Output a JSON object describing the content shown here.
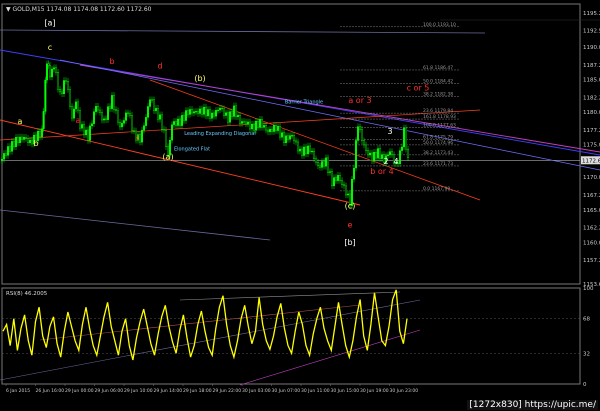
{
  "header": {
    "symbol": "GOLD,M15",
    "ohlc": "1174.08 1174.08 1172.60 1172.60"
  },
  "watermark": "[1272x830] https://upic.me/",
  "colors": {
    "bg": "#000000",
    "candle": "#00ff00",
    "price_line": "#aaaaaa",
    "rsi": "#ffff00",
    "wave_red": "#ff3030",
    "wave_yellow": "#ffff66",
    "wave_white": "#ffffff",
    "channel_blue": "#4040ff",
    "channel_red": "#ff4020",
    "channel_magenta": "#c040c0",
    "fib": "#808080",
    "annot": "#66ccff"
  },
  "chart_data": [
    {
      "type": "candlestick",
      "title": "GOLD,M15",
      "y_ticks": [
        1195.25,
        1192.5,
        1190.0,
        1187.25,
        1185.0,
        1182.25,
        1180.0,
        1177.25,
        1175.0,
        1172.6,
        1170.0,
        1167.25,
        1165.0,
        1162.25,
        1160.0,
        1157.25,
        1153.6
      ],
      "ylim": [
        1153.6,
        1196.6
      ],
      "current_price": 1172.6,
      "x_ticks": [
        "6 Jan 2015",
        "26 Jun 16:00",
        "29 Jun 00:00",
        "29 Jun 06:00",
        "29 Jun 10:00",
        "29 Jun 14:00",
        "29 Jun 18:00",
        "29 Jun 22:00",
        "30 Jun 03:00",
        "30 Jun 07:00",
        "30 Jun 11:00",
        "30 Jun 15:00",
        "30 Jun 19:00",
        "30 Jun 23:00"
      ],
      "close_path": [
        [
          0,
          1172.5
        ],
        [
          8,
          1174.2
        ],
        [
          16,
          1175.6
        ],
        [
          24,
          1176.1
        ],
        [
          30,
          1175.3
        ],
        [
          36,
          1176.2
        ],
        [
          42,
          1177.0
        ],
        [
          47,
          1188.0
        ],
        [
          50,
          1185.5
        ],
        [
          54,
          1187.2
        ],
        [
          60,
          1182.5
        ],
        [
          66,
          1185.2
        ],
        [
          72,
          1179.0
        ],
        [
          76,
          1181.8
        ],
        [
          80,
          1178.0
        ],
        [
          88,
          1176.2
        ],
        [
          96,
          1181.0
        ],
        [
          104,
          1178.5
        ],
        [
          112,
          1182.0
        ],
        [
          120,
          1177.6
        ],
        [
          128,
          1180.2
        ],
        [
          134,
          1176.5
        ],
        [
          140,
          1175.8
        ],
        [
          146,
          1179.2
        ],
        [
          150,
          1182.2
        ],
        [
          156,
          1180.0
        ],
        [
          160,
          1179.0
        ],
        [
          164,
          1176.8
        ],
        [
          168,
          1173.2
        ],
        [
          172,
          1178.2
        ],
        [
          180,
          1178.5
        ],
        [
          188,
          1180.1
        ],
        [
          196,
          1180.0
        ],
        [
          204,
          1180.2
        ],
        [
          212,
          1179.4
        ],
        [
          220,
          1180.7
        ],
        [
          228,
          1179.0
        ],
        [
          234,
          1180.4
        ],
        [
          240,
          1178.5
        ],
        [
          246,
          1178.4
        ],
        [
          252,
          1177.6
        ],
        [
          260,
          1178.4
        ],
        [
          268,
          1177.0
        ],
        [
          276,
          1177.7
        ],
        [
          284,
          1175.8
        ],
        [
          292,
          1176.4
        ],
        [
          300,
          1173.8
        ],
        [
          310,
          1174.4
        ],
        [
          318,
          1171.6
        ],
        [
          326,
          1172.4
        ],
        [
          332,
          1169.2
        ],
        [
          338,
          1170.1
        ],
        [
          344,
          1168.4
        ],
        [
          350,
          1166.2
        ],
        [
          354,
          1172.0
        ],
        [
          358,
          1178.2
        ],
        [
          362,
          1175.8
        ],
        [
          366,
          1174.0
        ],
        [
          372,
          1173.0
        ],
        [
          378,
          1173.8
        ],
        [
          384,
          1172.6
        ],
        [
          390,
          1174.0
        ],
        [
          396,
          1171.7
        ],
        [
          400,
          1173.5
        ],
        [
          404,
          1177.0
        ],
        [
          408,
          1172.6
        ]
      ],
      "wave_labels": [
        {
          "text": "[a]",
          "x": 50,
          "y": 1193.3,
          "color": "white"
        },
        {
          "text": "c",
          "x": 50,
          "y": 1189.5,
          "color": "yellow"
        },
        {
          "text": "b",
          "x": 112,
          "y": 1187.4,
          "color": "red"
        },
        {
          "text": "d",
          "x": 160,
          "y": 1186.7,
          "color": "red"
        },
        {
          "text": "(b)",
          "x": 200,
          "y": 1184.8,
          "color": "yellow"
        },
        {
          "text": "a",
          "x": 20,
          "y": 1178.2,
          "color": "yellow"
        },
        {
          "text": "b",
          "x": 36,
          "y": 1174.8,
          "color": "yellow"
        },
        {
          "text": "a",
          "x": 78,
          "y": 1178.3,
          "color": "red"
        },
        {
          "text": "c",
          "x": 138,
          "y": 1175.7,
          "color": "red"
        },
        {
          "text": "(a)",
          "x": 168,
          "y": 1172.7,
          "color": "yellow"
        },
        {
          "text": "a or 3",
          "x": 360,
          "y": 1181.4,
          "color": "red"
        },
        {
          "text": "c or 5",
          "x": 418,
          "y": 1183.3,
          "color": "red"
        },
        {
          "text": "b or 4",
          "x": 382,
          "y": 1170.5,
          "color": "red"
        },
        {
          "text": "(c)",
          "x": 350,
          "y": 1165.2,
          "color": "yellow"
        },
        {
          "text": "e",
          "x": 350,
          "y": 1162.3,
          "color": "red"
        },
        {
          "text": "[b]",
          "x": 350,
          "y": 1159.6,
          "color": "white"
        },
        {
          "text": "3",
          "x": 390,
          "y": 1176.6,
          "color": "white"
        },
        {
          "text": "2",
          "x": 386,
          "y": 1172.0,
          "color": "white"
        },
        {
          "text": "4",
          "x": 396,
          "y": 1172.0,
          "color": "white"
        }
      ],
      "annotations": [
        {
          "text": "Barrier Triangle",
          "x": 304,
          "y": 1181.3
        },
        {
          "text": "Leading Expanding Diagonal",
          "x": 220,
          "y": 1176.5
        },
        {
          "text": "Elongated Flat",
          "x": 192,
          "y": 1174.1
        }
      ],
      "fib_levels": [
        {
          "label": "100.0",
          "value": 1193.1
        },
        {
          "label": "61.8",
          "value": 1186.47
        },
        {
          "label": "50.0",
          "value": 1184.42
        },
        {
          "label": "38.2",
          "value": 1182.38
        },
        {
          "label": "23.6",
          "value": 1179.84
        },
        {
          "label": "161.8",
          "value": 1178.93
        },
        {
          "label": "100.0",
          "value": 1177.63
        },
        {
          "label": "61.8",
          "value": 1175.79
        },
        {
          "label": "50.0",
          "value": 1174.96
        },
        {
          "label": "38.2",
          "value": 1173.43
        },
        {
          "label": "23.6",
          "value": 1171.73
        },
        {
          "label": "0.0",
          "value": 1167.9
        }
      ]
    },
    {
      "type": "line",
      "title": "RSI(8) 46.2005",
      "ylim": [
        0,
        100
      ],
      "y_ticks": [
        100,
        68,
        32,
        0
      ],
      "values": [
        55,
        62,
        40,
        68,
        35,
        58,
        72,
        45,
        30,
        65,
        80,
        50,
        38,
        60,
        70,
        42,
        28,
        55,
        75,
        60,
        45,
        35,
        62,
        80,
        58,
        40,
        30,
        50,
        70,
        85,
        60,
        45,
        30,
        55,
        68,
        40,
        25,
        48,
        65,
        78,
        60,
        42,
        30,
        52,
        70,
        82,
        60,
        44,
        32,
        56,
        72,
        48,
        28,
        40,
        62,
        76,
        55,
        38,
        30,
        58,
        80,
        92,
        62,
        40,
        28,
        45,
        68,
        82,
        60,
        42,
        55,
        90,
        62,
        45,
        36,
        50,
        70,
        84,
        58,
        40,
        32,
        55,
        75,
        62,
        40,
        30,
        52,
        68,
        80,
        58,
        45,
        35,
        60,
        85,
        62,
        40,
        28,
        45,
        70,
        88,
        50,
        35,
        62,
        95,
        70,
        45,
        40,
        60,
        88,
        98,
        55,
        42,
        68
      ]
    }
  ]
}
